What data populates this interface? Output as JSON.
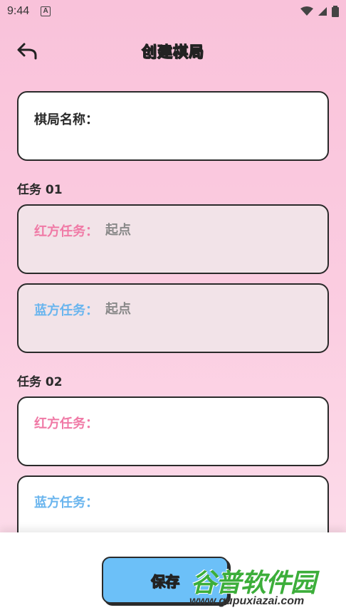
{
  "status_bar": {
    "time": "9:44",
    "badge": "A"
  },
  "header": {
    "title": "创建棋局"
  },
  "name_field": {
    "label": "棋局名称："
  },
  "tasks": [
    {
      "title": "任务 01",
      "red": {
        "label": "红方任务：",
        "value": "起点"
      },
      "blue": {
        "label": "蓝方任务：",
        "value": "起点"
      }
    },
    {
      "title": "任务 02",
      "red": {
        "label": "红方任务：",
        "value": ""
      },
      "blue": {
        "label": "蓝方任务：",
        "value": ""
      }
    }
  ],
  "bottom": {
    "save_label": "保存"
  },
  "watermark": {
    "main": "谷普软件园",
    "url": "www.gupuxiazai.com"
  },
  "colors": {
    "red_label": "#f07aa6",
    "blue_label": "#6ab5ee",
    "save_button": "#6cc0f8",
    "background": "#f9c2da"
  }
}
